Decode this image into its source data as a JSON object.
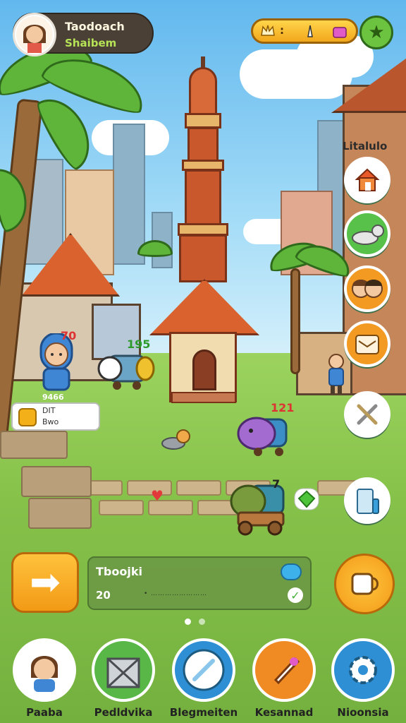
{
  "profile": {
    "name": "Taodoach",
    "subtitle": "Shaibem"
  },
  "resources": {
    "value": ":"
  },
  "side_menu": {
    "label": "Litalulo",
    "buttons": [
      {
        "icon": "house-icon",
        "color": "#ffffff"
      },
      {
        "icon": "cat-icon",
        "color": "#58c14a"
      },
      {
        "icon": "friends-icon",
        "color": "#f29a22"
      },
      {
        "icon": "mail-icon",
        "color": "#f29a22"
      },
      {
        "icon": "tools-icon",
        "color": "#ffffff"
      },
      {
        "icon": "store-icon",
        "color": "#ffffff"
      }
    ]
  },
  "scene": {
    "npc_tag": "70",
    "npc_label": "9466",
    "cart_tag": "195",
    "pig_tag": "121",
    "cart2_tag": "7"
  },
  "info_card": {
    "line1": "DIT",
    "line2": "Bwo"
  },
  "quest": {
    "title": "Tboojki",
    "count": "20",
    "progress_text": "• ……………………"
  },
  "bottom_nav": [
    {
      "label": "Paaba",
      "color": "#ffffff"
    },
    {
      "label": "Pedldvika",
      "color": "#58b746"
    },
    {
      "label": "Blegmeiten",
      "color": "#2e8fd4"
    },
    {
      "label": "Kesannad",
      "color": "#f08a22"
    },
    {
      "label": "Nioonsia",
      "color": "#2e8fd4"
    }
  ]
}
